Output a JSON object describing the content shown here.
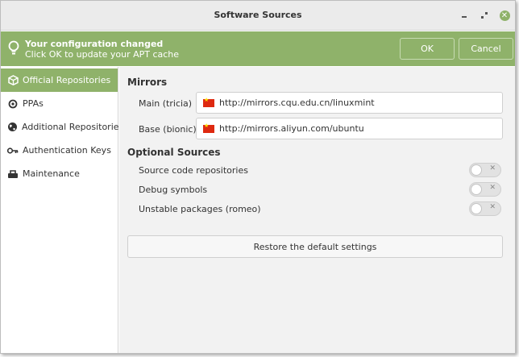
{
  "window": {
    "title": "Software Sources",
    "controls": {
      "minimize": "minimize",
      "maximize": "maximize",
      "close": "close"
    }
  },
  "infobar": {
    "title": "Your configuration changed",
    "subtitle": "Click OK to update your APT cache",
    "ok_label": "OK",
    "cancel_label": "Cancel",
    "icon": "lightbulb-icon"
  },
  "sidebar": {
    "items": [
      {
        "label": "Official Repositories",
        "icon": "package-icon",
        "active": true
      },
      {
        "label": "PPAs",
        "icon": "ppa-icon",
        "active": false
      },
      {
        "label": "Additional Repositories",
        "icon": "globe-icon",
        "active": false
      },
      {
        "label": "Authentication Keys",
        "icon": "key-icon",
        "active": false
      },
      {
        "label": "Maintenance",
        "icon": "tools-icon",
        "active": false
      }
    ]
  },
  "mirrors": {
    "title": "Mirrors",
    "main_label": "Main (tricia)",
    "main_url": "http://mirrors.cqu.edu.cn/linuxmint",
    "base_label": "Base (bionic)",
    "base_url": "http://mirrors.aliyun.com/ubuntu"
  },
  "optional": {
    "title": "Optional Sources",
    "items": [
      {
        "label": "Source code repositories",
        "enabled": false
      },
      {
        "label": "Debug symbols",
        "enabled": false
      },
      {
        "label": "Unstable packages (romeo)",
        "enabled": false
      }
    ]
  },
  "restore_label": "Restore the default settings",
  "colors": {
    "accent": "#8fb26a",
    "background": "#f2f2f2",
    "flag_red": "#de2910",
    "flag_yellow": "#ffde00"
  }
}
